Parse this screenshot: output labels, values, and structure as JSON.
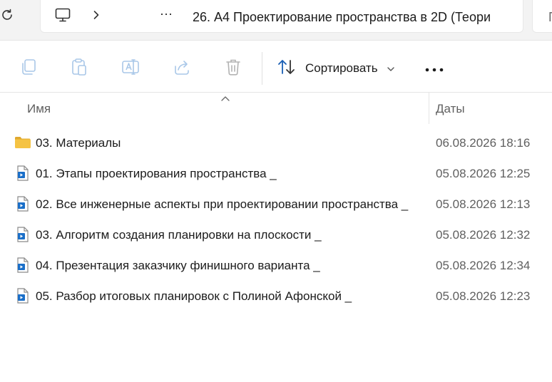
{
  "address": {
    "breadcrumb_separator_icon": "chevron-right-icon",
    "more_label": "···",
    "path_title": "26. А4 Проектирование пространства в 2D (Теори",
    "search_fragment": "П"
  },
  "toolbar": {
    "sort_label": "Сортировать",
    "more_label": "•••"
  },
  "columns": {
    "name": "Имя",
    "date": "Даты"
  },
  "files": [
    {
      "name": "03. Материалы",
      "date": "06.08.2026 18:16",
      "icon": "folder-icon"
    },
    {
      "name": "01. Этапы проектирования пространства _",
      "date": "05.08.2026 12:25",
      "icon": "video-file-icon"
    },
    {
      "name": "02. Все инженерные аспекты при проектировании пространства _",
      "date": "05.08.2026 12:13",
      "icon": "video-file-icon"
    },
    {
      "name": "03. Алгоритм создания планировки на плоскости _",
      "date": "05.08.2026 12:32",
      "icon": "video-file-icon"
    },
    {
      "name": "04. Презентация заказчику финишного варианта _",
      "date": "05.08.2026 12:34",
      "icon": "video-file-icon"
    },
    {
      "name": "05. Разбор итоговых планировок с Полиной Афонской _",
      "date": "05.08.2026 12:23",
      "icon": "video-file-icon"
    }
  ],
  "colors": {
    "accent": "#1a5fb4",
    "folder": "#f5c343",
    "disabled_icon": "#a9c7e8"
  }
}
